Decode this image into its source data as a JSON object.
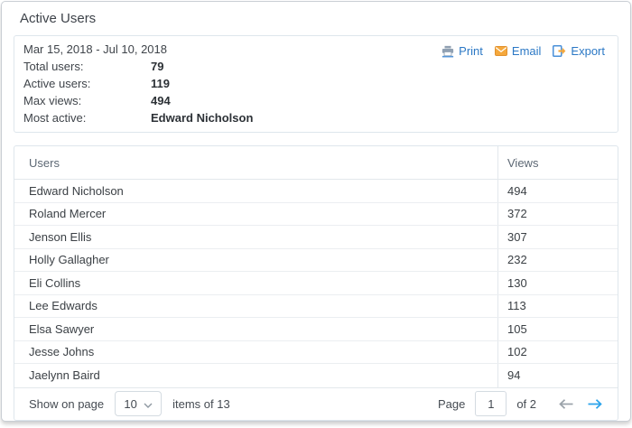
{
  "title": "Active Users",
  "summary": {
    "date_range": "Mar 15, 2018 - Jul 10, 2018",
    "rows": [
      {
        "label": "Total users:",
        "value": "79"
      },
      {
        "label": "Active users:",
        "value": "119"
      },
      {
        "label": "Max views:",
        "value": "494"
      },
      {
        "label": "Most active:",
        "value": "Edward Nicholson"
      }
    ],
    "actions": [
      {
        "label": "Print",
        "icon": "printer-icon"
      },
      {
        "label": "Email",
        "icon": "email-icon"
      },
      {
        "label": "Export",
        "icon": "export-icon"
      }
    ]
  },
  "table": {
    "columns": {
      "users": "Users",
      "views": "Views"
    },
    "rows": [
      {
        "user": "Edward Nicholson",
        "views": "494"
      },
      {
        "user": "Roland Mercer",
        "views": "372"
      },
      {
        "user": "Jenson Ellis",
        "views": "307"
      },
      {
        "user": "Holly Gallagher",
        "views": "232"
      },
      {
        "user": "Eli Collins",
        "views": "130"
      },
      {
        "user": "Lee Edwards",
        "views": "113"
      },
      {
        "user": "Elsa Sawyer",
        "views": "105"
      },
      {
        "user": "Jesse Johns",
        "views": "102"
      },
      {
        "user": "Jaelynn Baird",
        "views": "94"
      }
    ]
  },
  "pagination": {
    "show_on_page_label": "Show on page",
    "page_size": "10",
    "items_label": "items of 13",
    "page_label": "Page",
    "current_page": "1",
    "of_label": "of 2"
  },
  "colors": {
    "link_blue": "#2b78c5",
    "arrow_blue": "#2aa3eb",
    "arrow_gray": "#9aa2a9",
    "icon_orange": "#f5a83c",
    "icon_slate": "#90a0b2",
    "border_light": "#dee6ec"
  }
}
